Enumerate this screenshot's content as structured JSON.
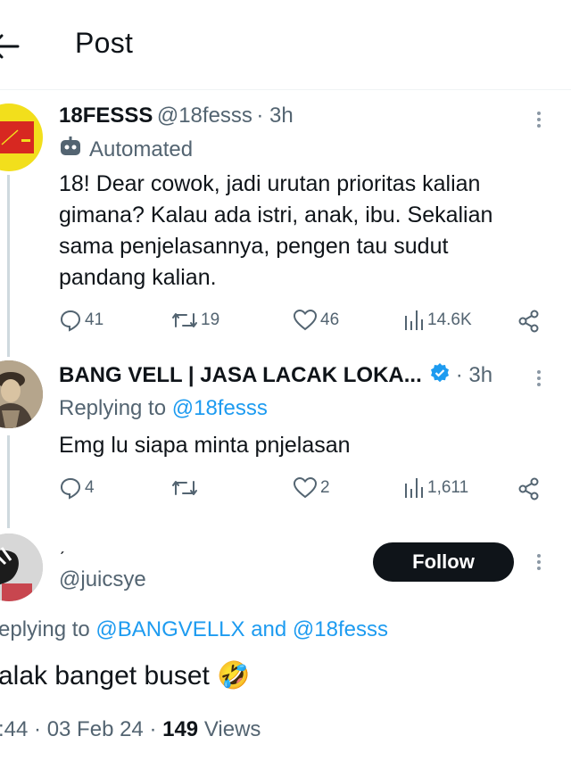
{
  "header": {
    "title": "Post"
  },
  "tweet1": {
    "name": "18FESSS",
    "handle": "@18fesss",
    "time": "· 3h",
    "automated_label": "Automated",
    "text": "18! Dear cowok, jadi urutan prioritas kalian gimana? Kalau ada istri, anak, ibu. Sekalian sama penjelasannya, pengen tau sudut pandang kalian.",
    "replies": "41",
    "reposts": "19",
    "likes": "46",
    "views": "14.6K"
  },
  "tweet2": {
    "name": "BANG VELL | JASA LACAK LOKA...",
    "time": "· 3h",
    "replying_prefix": "Replying to",
    "replying_handle": "@18fesss",
    "text": "Emg lu siapa minta pnjelasan",
    "replies": "4",
    "likes": "2",
    "views": "1,611"
  },
  "tweet3": {
    "name": "ˏ",
    "handle": "@juicsye",
    "follow_label": "Follow",
    "replying_prefix": "eplying to",
    "replying_handle1": "@BANGVELLX",
    "replying_and": "and",
    "replying_handle2": "@18fesss",
    "text": "alak banget buset",
    "emoji": "🤣",
    "time_partial": ":44 · 03 Feb 24 ·",
    "views_count": "149",
    "views_label": "Views"
  },
  "colors": {
    "accent": "#1d9bf0",
    "verified": "#1d9bf0",
    "text": "#0f1419",
    "muted": "#536471"
  }
}
